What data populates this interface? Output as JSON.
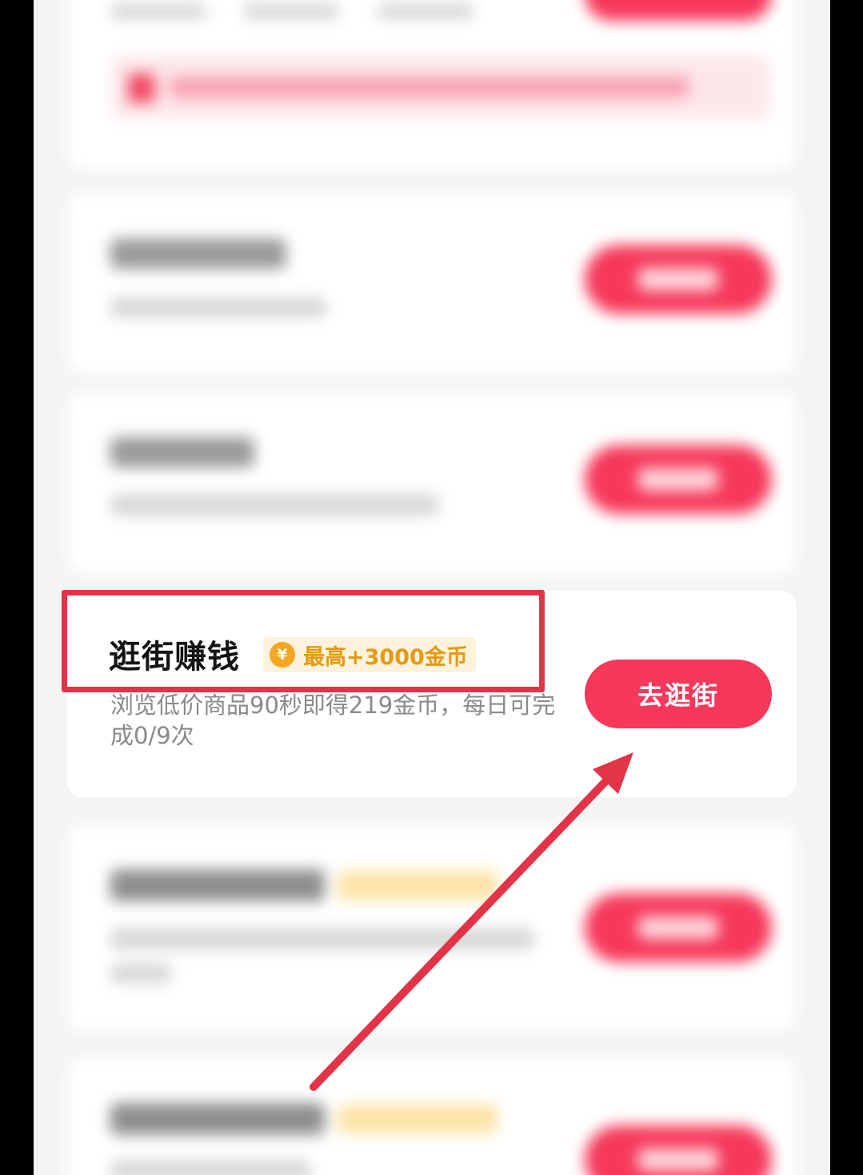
{
  "task": {
    "title": "逛街赚钱",
    "reward_icon": "¥",
    "reward_label": "最高+3000金币",
    "description": "浏览低价商品90秒即得219金币，每日可完成0/9次",
    "button_label": "去逛街"
  },
  "colors": {
    "accent": "#f6385b",
    "annotation": "#e33346",
    "reward": "#e49a12",
    "reward_bg": "#fdf2dc"
  }
}
